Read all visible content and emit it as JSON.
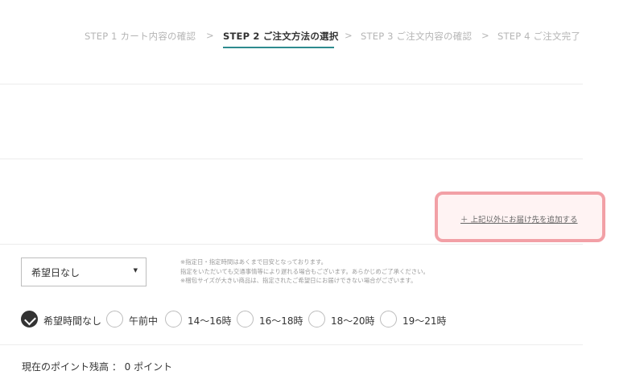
{
  "steps": [
    {
      "label": "STEP 1  カート内容の確認"
    },
    {
      "label": "STEP 2  ご注文方法の選択"
    },
    {
      "label": "STEP 3  ご注文内容の確認"
    },
    {
      "label": "STEP 4  ご注文完了"
    }
  ],
  "active_step": 2,
  "step_separator": ">",
  "add_address_label": "＋ 上記以外にお届け先を追加する",
  "delivery_date": {
    "selected": "希望日なし"
  },
  "notes": [
    "※指定日・指定時間はあくまで目安となっております。",
    "指定をいただいても交通事情等により遅れる場合もございます。あらかじめご了承ください。",
    "※梱包サイズが大きい商品は、指定されたご希望日にお届けできない場合がございます。"
  ],
  "time_options": [
    {
      "label": "希望時間なし",
      "checked": true
    },
    {
      "label": "午前中",
      "checked": false
    },
    {
      "label": "14〜16時",
      "checked": false
    },
    {
      "label": "16〜18時",
      "checked": false
    },
    {
      "label": "18〜20時",
      "checked": false
    },
    {
      "label": "19〜21時",
      "checked": false
    }
  ],
  "points_text": "現在のポイント残高 ： 0 ポイント",
  "colors": {
    "accent": "#2e8b8f",
    "highlight_border": "#f2a0a6",
    "highlight_bg": "#fff3f3"
  }
}
